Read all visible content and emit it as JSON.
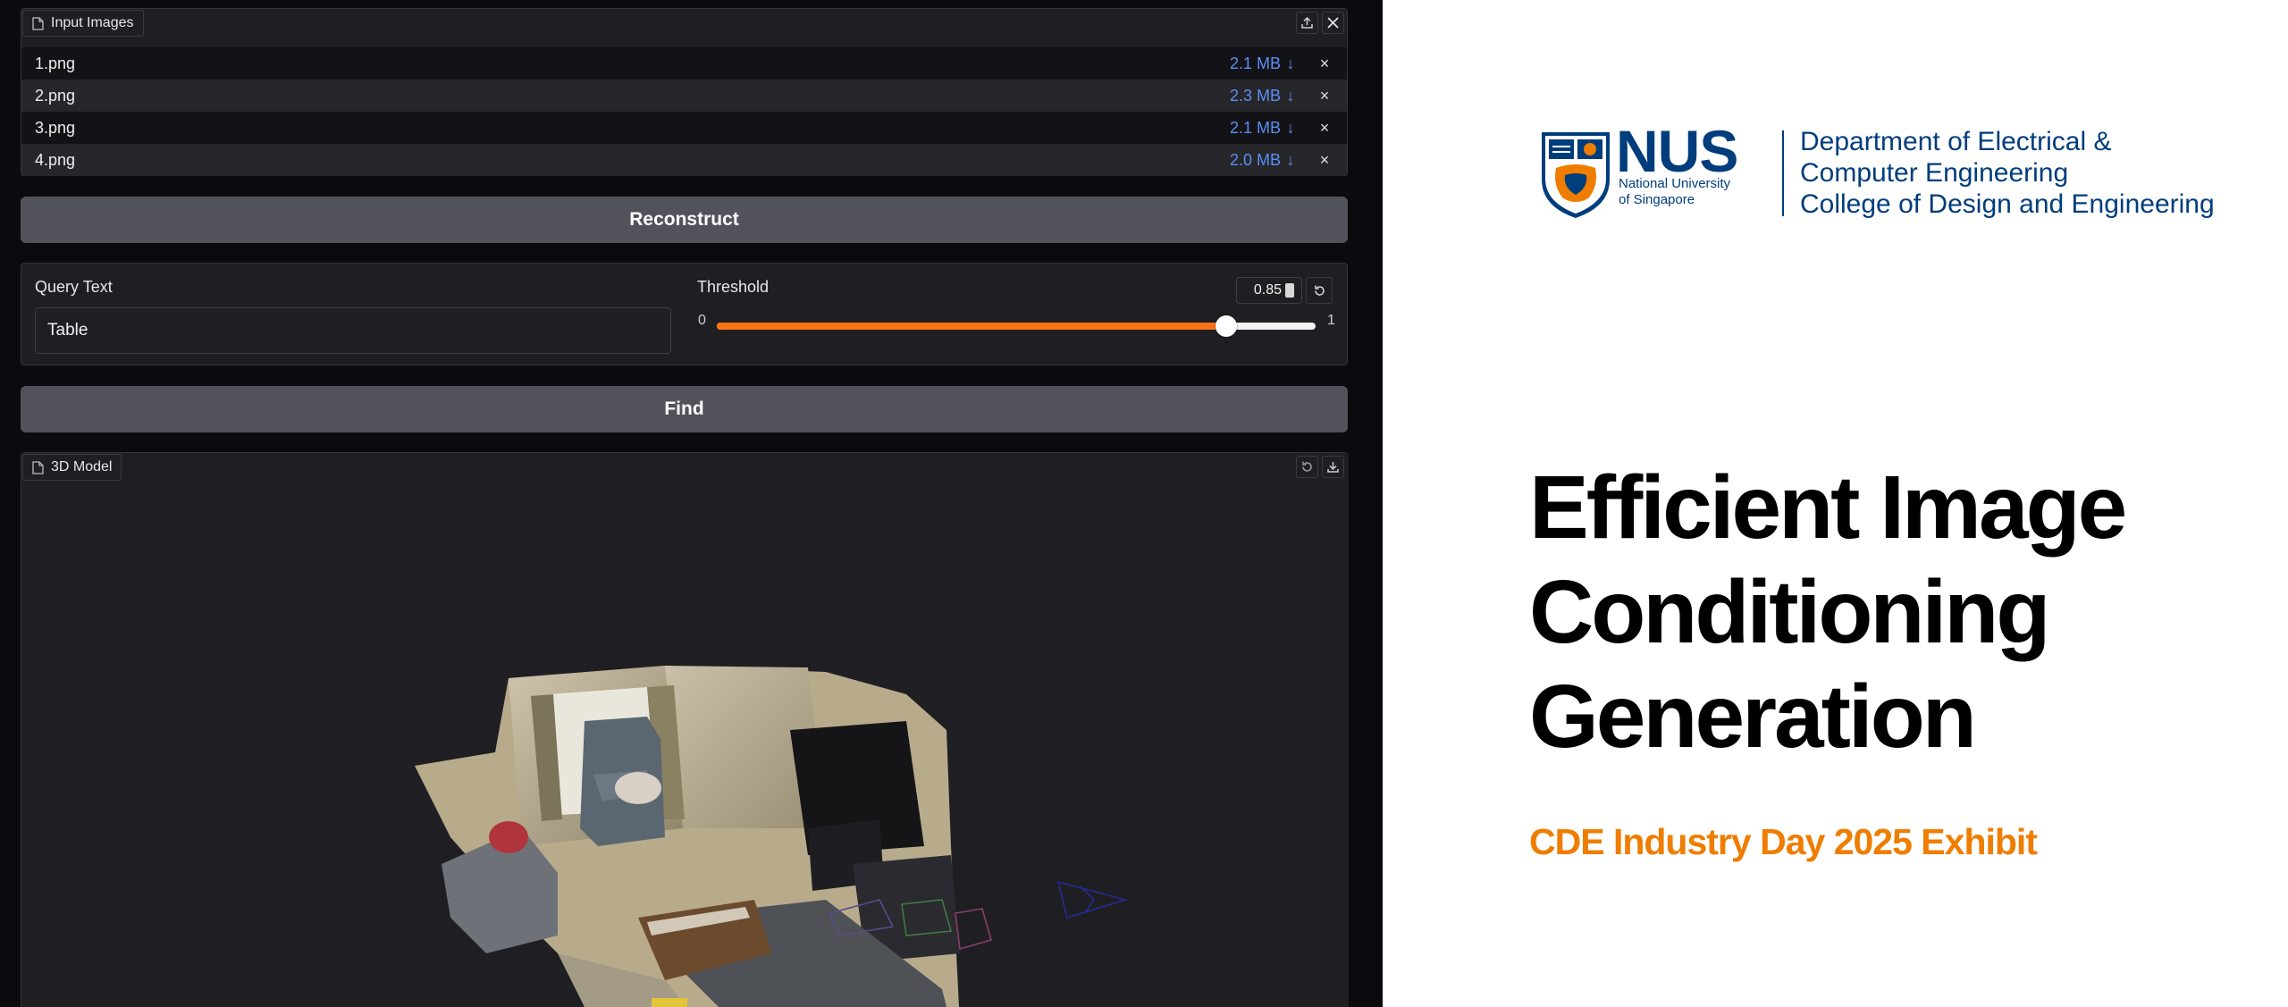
{
  "input_images": {
    "label": "Input Images",
    "files": [
      {
        "name": "1.png",
        "size": "2.1 MB"
      },
      {
        "name": "2.png",
        "size": "2.3 MB"
      },
      {
        "name": "3.png",
        "size": "2.1 MB"
      },
      {
        "name": "4.png",
        "size": "2.0 MB"
      }
    ],
    "download_glyph": "↓",
    "remove_glyph": "×"
  },
  "reconstruct_label": "Reconstruct",
  "query": {
    "label": "Query Text",
    "value": "Table"
  },
  "threshold": {
    "label": "Threshold",
    "value": 0.85,
    "value_text": "0.85",
    "min": "0",
    "max": "1"
  },
  "find_label": "Find",
  "model_panel": {
    "label": "3D Model"
  },
  "branding": {
    "logo_text": "NUS",
    "logo_sub": [
      "National University",
      "of Singapore"
    ],
    "department_lines": [
      "Department of Electrical &",
      "Computer Engineering",
      "College of Design and Engineering"
    ],
    "title_lines": [
      "Efficient Image",
      "Conditioning",
      "Generation"
    ],
    "subtitle": "CDE Industry Day 2025 Exhibit"
  },
  "colors": {
    "accent_orange": "#f97316",
    "link_blue": "#5b8ff2",
    "nus_blue": "#003d7c",
    "nus_orange": "#ef7d00"
  },
  "icons": {
    "file": "file-icon",
    "upload": "upload-icon",
    "close": "close-icon",
    "reset": "reset-icon",
    "undo": "undo-icon",
    "download": "download-icon"
  }
}
